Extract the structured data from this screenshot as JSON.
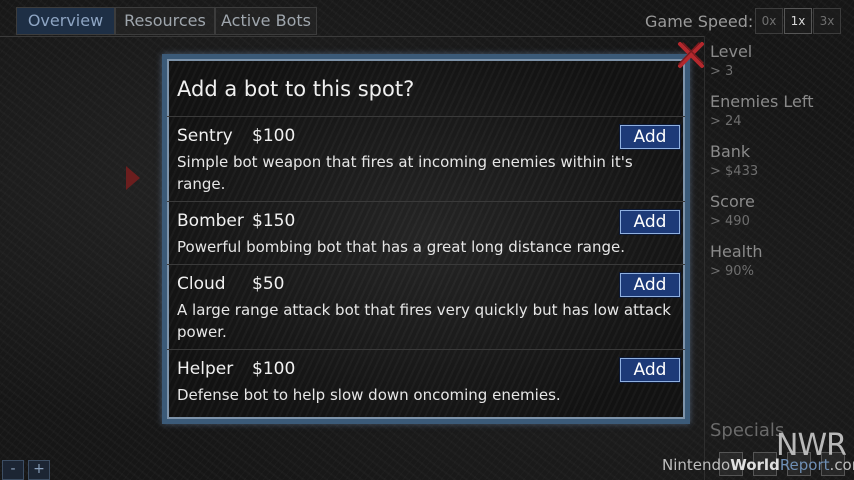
{
  "tabs": [
    {
      "label": "Overview",
      "active": true
    },
    {
      "label": "Resources",
      "active": false
    },
    {
      "label": "Active Bots",
      "active": false
    }
  ],
  "game_speed": {
    "label": "Game Speed:",
    "options": [
      "0x",
      "1x",
      "3x"
    ],
    "selected": "1x"
  },
  "stats": [
    {
      "label": "Level",
      "value": "> 3"
    },
    {
      "label": "Enemies Left",
      "value": "> 24"
    },
    {
      "label": "Bank",
      "value": "> $433"
    },
    {
      "label": "Score",
      "value": "> 490"
    },
    {
      "label": "Health",
      "value": "> 90%"
    }
  ],
  "specials_label": "Specials",
  "zoom": {
    "minus": "-",
    "plus": "+"
  },
  "dialog": {
    "title": "Add a bot to this spot?",
    "add_label": "Add",
    "bots": [
      {
        "name": "Sentry",
        "price": "$100",
        "description": "Simple bot weapon that fires at incoming enemies within it's range."
      },
      {
        "name": "Bomber",
        "price": "$150",
        "description": "Powerful bombing bot that has a great long distance range."
      },
      {
        "name": "Cloud",
        "price": "$50",
        "description": "A large range attack bot that fires very quickly but has low attack power."
      },
      {
        "name": "Helper",
        "price": "$100",
        "description": "Defense bot to help slow down oncoming enemies."
      }
    ]
  },
  "watermark": {
    "logo": "NWR",
    "part1": "Nintendo",
    "part2": "World",
    "part3": "Report",
    "part4": ".com"
  },
  "colors": {
    "accent": "#1d3a78",
    "dialog_border": "#3b5a78",
    "close_x": "#b3282d"
  }
}
